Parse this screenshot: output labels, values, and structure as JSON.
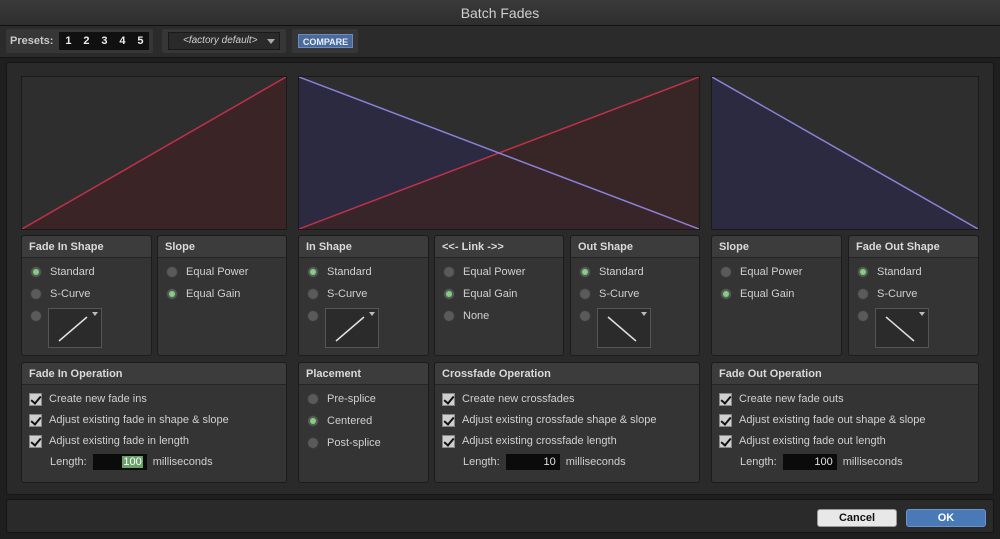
{
  "window": {
    "title": "Batch Fades"
  },
  "toolbar": {
    "presets_label": "Presets:",
    "presets": [
      "1",
      "2",
      "3",
      "4",
      "5"
    ],
    "factory_preset": "<factory default>",
    "compare_label": "COMPARE"
  },
  "fade_in_shape": {
    "title": "Fade In Shape",
    "options": [
      "Standard",
      "S-Curve"
    ],
    "selected": "Standard"
  },
  "fade_in_slope": {
    "title": "Slope",
    "options": [
      "Equal Power",
      "Equal Gain"
    ],
    "selected": "Equal Gain"
  },
  "xfade_in_shape": {
    "title": "In Shape",
    "options": [
      "Standard",
      "S-Curve"
    ],
    "selected": "Standard"
  },
  "xfade_link": {
    "title": "<<- Link ->>",
    "options": [
      "Equal Power",
      "Equal Gain",
      "None"
    ],
    "selected": "Equal Gain"
  },
  "xfade_out_shape": {
    "title": "Out Shape",
    "options": [
      "Standard",
      "S-Curve"
    ],
    "selected": "Standard"
  },
  "fade_out_slope": {
    "title": "Slope",
    "options": [
      "Equal Power",
      "Equal Gain"
    ],
    "selected": "Equal Gain"
  },
  "fade_out_shape": {
    "title": "Fade Out Shape",
    "options": [
      "Standard",
      "S-Curve"
    ],
    "selected": "Standard"
  },
  "fade_in_operation": {
    "title": "Fade In Operation",
    "checks": [
      "Create new fade ins",
      "Adjust existing fade in shape & slope",
      "Adjust existing fade in length"
    ],
    "length_label": "Length:",
    "length_value": "100",
    "length_unit": "milliseconds"
  },
  "placement": {
    "title": "Placement",
    "options": [
      "Pre-splice",
      "Centered",
      "Post-splice"
    ],
    "selected": "Centered"
  },
  "crossfade_operation": {
    "title": "Crossfade Operation",
    "checks": [
      "Create new crossfades",
      "Adjust existing crossfade shape & slope",
      "Adjust existing crossfade length"
    ],
    "length_label": "Length:",
    "length_value": "10",
    "length_unit": "milliseconds"
  },
  "fade_out_operation": {
    "title": "Fade Out Operation",
    "checks": [
      "Create new fade outs",
      "Adjust existing fade out shape & slope",
      "Adjust existing fade out length"
    ],
    "length_label": "Length:",
    "length_value": "100",
    "length_unit": "milliseconds"
  },
  "buttons": {
    "cancel": "Cancel",
    "ok": "OK"
  },
  "colors": {
    "fade_in_line": "#c0304a",
    "fade_out_line": "#8a80d8",
    "accent": "#4a79b8",
    "radio_on": "#7fd07f"
  }
}
